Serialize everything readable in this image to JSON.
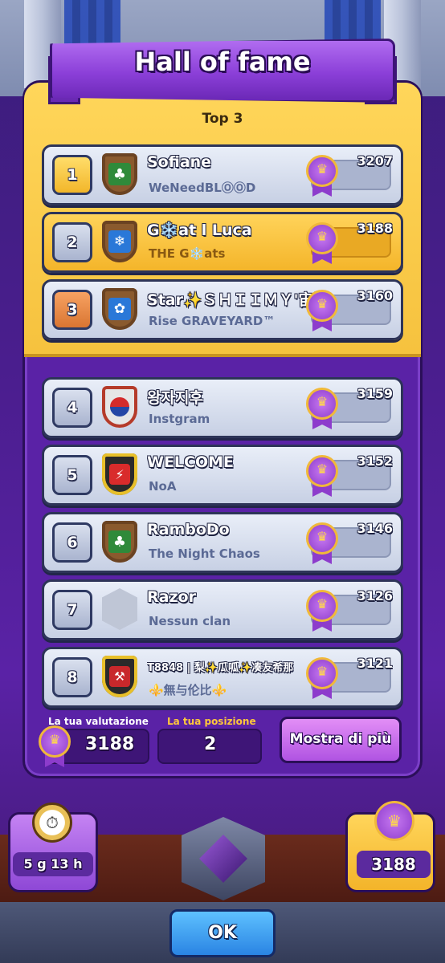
{
  "title": "Hall of fame",
  "section_label": "Top 3",
  "players": [
    {
      "rank": "1",
      "name": "Sofiane",
      "clan": "WeNeedBLⓄⓄD",
      "trophies": "3207",
      "badge": "clover-badge-icon"
    },
    {
      "rank": "2",
      "name": "G❄️at l Luca",
      "clan": "THE G❄️ats",
      "trophies": "3188",
      "badge": "snowflake-badge-icon"
    },
    {
      "rank": "3",
      "name": "Star✨ＳＨＩＩＭＹ'宙斯",
      "clan": "Rise GRAVEYARD™",
      "trophies": "3160",
      "badge": "flower-badge-icon"
    },
    {
      "rank": "4",
      "name": "왕자지후",
      "clan": "Instgram",
      "trophies": "3159",
      "badge": "korea-badge-icon"
    },
    {
      "rank": "5",
      "name": "WELCOME",
      "clan": "NoA",
      "trophies": "3152",
      "badge": "lightning-badge-icon"
    },
    {
      "rank": "6",
      "name": "RamboDo",
      "clan": "The Night Chaos",
      "trophies": "3146",
      "badge": "clover-badge-icon"
    },
    {
      "rank": "7",
      "name": "Razor",
      "clan": "Nessun clan",
      "trophies": "3126",
      "badge": "no-clan-badge-icon"
    },
    {
      "rank": "8",
      "name": "T8848 | 梨✨瓜呱✨凑友希那",
      "clan": "⚜️無与伦比⚜️",
      "trophies": "3121",
      "badge": "hammer-badge-icon"
    }
  ],
  "your_rating_label": "La tua valutazione",
  "your_rating": "3188",
  "your_position_label": "La tua posizione",
  "your_position": "2",
  "show_more": "Mostra di più",
  "season_timer": "5 g 13 h",
  "total_trophies": "3188",
  "ok_label": "OK",
  "colors": {
    "gold": "#f6c23e",
    "purple": "#5a22a6",
    "blue_button": "#2a84e3"
  },
  "icons": {
    "crown": "crown-medal-icon",
    "timer": "stopwatch-icon",
    "league": "league-shield-icon"
  }
}
